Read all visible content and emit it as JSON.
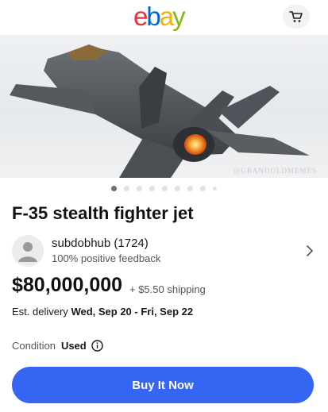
{
  "header": {
    "logo": [
      "e",
      "b",
      "a",
      "y"
    ],
    "cart_icon": "cart-icon"
  },
  "hero": {
    "watermark": "@GRANDOLDMEMES",
    "image_count": 9,
    "current_image": 1
  },
  "listing": {
    "title": "F-35 stealth fighter jet",
    "seller_name": "subdobhub (1724)",
    "seller_feedback": "100% positive feedback",
    "price": "$80,000,000",
    "shipping": "+ $5.50 shipping",
    "delivery_prefix": "Est. delivery",
    "delivery_dates": "Wed, Sep 20 - Fri, Sep 22",
    "condition_label": "Condition",
    "condition_value": "Used",
    "buy_label": "Buy It Now"
  },
  "colors": {
    "accent": "#3665f3",
    "logo_e": "#e53238",
    "logo_b": "#0064d2",
    "logo_a": "#f5af02",
    "logo_y": "#86b817"
  }
}
